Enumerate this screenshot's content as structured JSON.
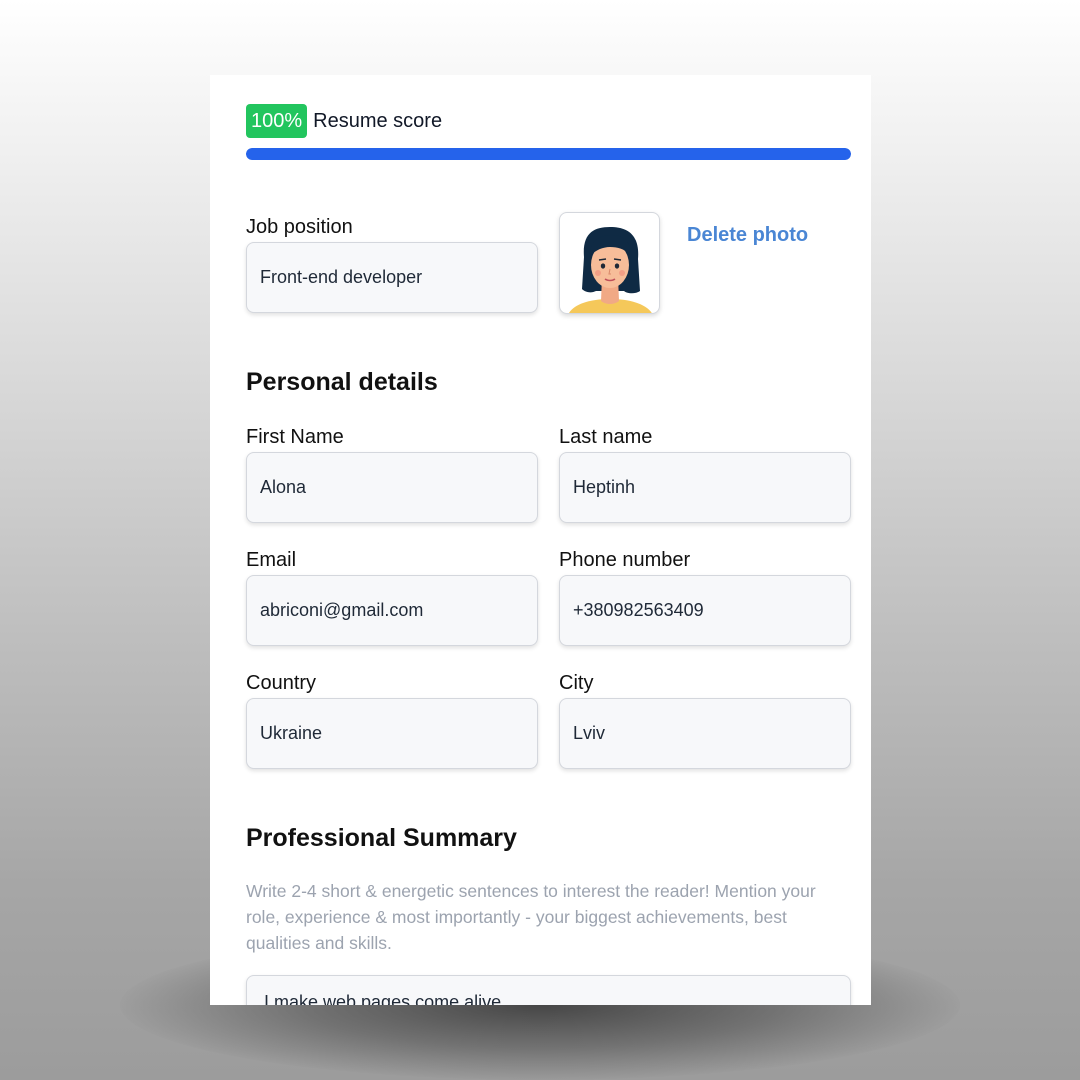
{
  "score": {
    "badge": "100%",
    "label": "Resume score",
    "progress_percent": 100,
    "badge_color": "#22c55e",
    "bar_color": "#2563eb"
  },
  "job": {
    "label": "Job position",
    "value": "Front-end developer"
  },
  "photo": {
    "icon": "avatar-photo",
    "delete_label": "Delete photo",
    "link_color": "#4a86d4"
  },
  "personal": {
    "title": "Personal details",
    "first_name": {
      "label": "First Name",
      "value": "Alona"
    },
    "last_name": {
      "label": "Last name",
      "value": "Heptinh"
    },
    "email": {
      "label": "Email",
      "value": "abriconi@gmail.com"
    },
    "phone": {
      "label": "Phone number",
      "value": "+380982563409"
    },
    "country": {
      "label": "Country",
      "value": "Ukraine"
    },
    "city": {
      "label": "City",
      "value": "Lviv"
    }
  },
  "summary": {
    "title": "Professional Summary",
    "hint": "Write 2-4 short & energetic sentences to interest the reader! Mention your role, experience & most importantly - your biggest achievements, best qualities and skills.",
    "value": "I make web pages come alive"
  }
}
